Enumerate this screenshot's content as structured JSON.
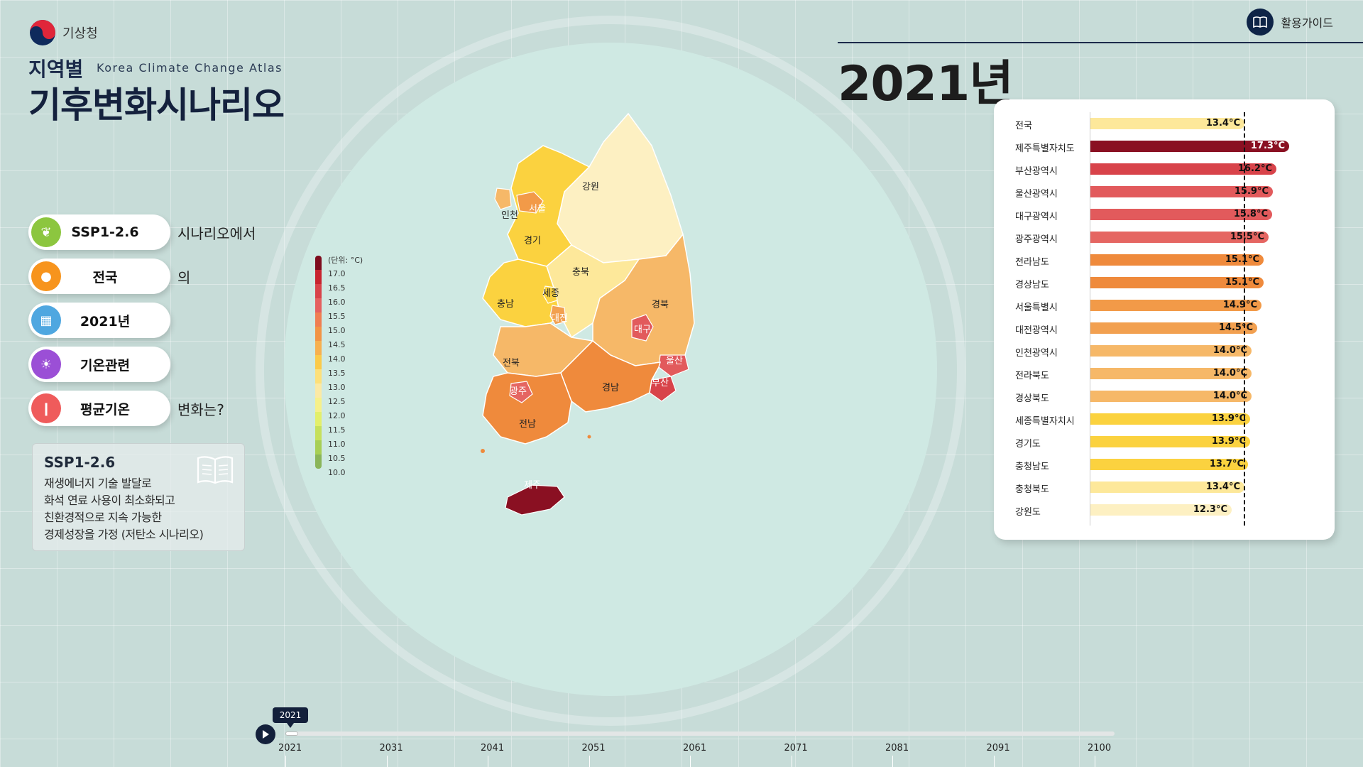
{
  "header": {
    "agency": "기상청",
    "title_sub": "지역별",
    "title_eng": "Korea Climate Change Atlas",
    "title_main": "기후변화시나리오",
    "guide_label": "활용가이드",
    "year_display": "2021년"
  },
  "selectors": [
    {
      "label": "SSP1-2.6",
      "suffix": "시나리오에서",
      "icon": "leaf-icon",
      "color": "#8cc63f"
    },
    {
      "label": "전국",
      "suffix": "의",
      "icon": "location-pin-icon",
      "color": "#f7941d"
    },
    {
      "label": "2021년",
      "suffix": "",
      "icon": "calendar-icon",
      "color": "#4fa7e0"
    },
    {
      "label": "기온관련",
      "suffix": "",
      "icon": "sun-icon",
      "color": "#9b4fd6"
    },
    {
      "label": "평균기온",
      "suffix": "변화는?",
      "icon": "thermometer-icon",
      "color": "#ef5b5b"
    }
  ],
  "description": {
    "title": "SSP1-2.6",
    "lines": [
      "재생에너지 기술 발달로",
      "화석 연료 사용이 최소화되고",
      "친환경적으로 지속 가능한",
      "경제성장을 가정 (저탄소 시나리오)"
    ]
  },
  "legend": {
    "unit": "(단위: °C)",
    "ticks": [
      "17.0",
      "16.5",
      "16.0",
      "15.5",
      "15.0",
      "14.5",
      "14.0",
      "13.5",
      "13.0",
      "12.5",
      "12.0",
      "11.5",
      "11.0",
      "10.5",
      "10.0"
    ],
    "colors": [
      "#7e0c1e",
      "#c8242f",
      "#d8434a",
      "#e5605f",
      "#ef7e52",
      "#f29445",
      "#f7b04f",
      "#fbca4a",
      "#fde07a",
      "#fbe9a5",
      "#f6f08a",
      "#e3ef6b",
      "#c6e05c",
      "#a7cf55",
      "#8ab55a"
    ]
  },
  "map": {
    "labels": [
      "강원",
      "인천",
      "서울",
      "경기",
      "충북",
      "경북",
      "세종",
      "충남",
      "대전",
      "대구",
      "전북",
      "울산",
      "경남",
      "부산",
      "광주",
      "전남",
      "제주"
    ]
  },
  "ranking": {
    "rows": [
      {
        "name": "전국",
        "value": 13.4,
        "label": "13.4°C",
        "color": "#fde89a"
      },
      {
        "name": "제주특별자치도",
        "value": 17.3,
        "label": "17.3°C",
        "color": "#8a1022"
      },
      {
        "name": "부산광역시",
        "value": 16.2,
        "label": "16.2°C",
        "color": "#d8434a"
      },
      {
        "name": "울산광역시",
        "value": 15.9,
        "label": "15.9°C",
        "color": "#e25a5c"
      },
      {
        "name": "대구광역시",
        "value": 15.8,
        "label": "15.8°C",
        "color": "#e25a5c"
      },
      {
        "name": "광주광역시",
        "value": 15.5,
        "label": "15.5°C",
        "color": "#e56662"
      },
      {
        "name": "전라남도",
        "value": 15.1,
        "label": "15.1°C",
        "color": "#ef8a3c"
      },
      {
        "name": "경상남도",
        "value": 15.1,
        "label": "15.1°C",
        "color": "#ef8a3c"
      },
      {
        "name": "서울특별시",
        "value": 14.9,
        "label": "14.9°C",
        "color": "#f29a48"
      },
      {
        "name": "대전광역시",
        "value": 14.5,
        "label": "14.5°C",
        "color": "#f2a050"
      },
      {
        "name": "인천광역시",
        "value": 14.0,
        "label": "14.0°C",
        "color": "#f6b868"
      },
      {
        "name": "전라북도",
        "value": 14.0,
        "label": "14.0°C",
        "color": "#f6b868"
      },
      {
        "name": "경상북도",
        "value": 14.0,
        "label": "14.0°C",
        "color": "#f6b868"
      },
      {
        "name": "세종특별자치시",
        "value": 13.9,
        "label": "13.9°C",
        "color": "#fbd23f"
      },
      {
        "name": "경기도",
        "value": 13.9,
        "label": "13.9°C",
        "color": "#fbd23f"
      },
      {
        "name": "충청남도",
        "value": 13.7,
        "label": "13.7°C",
        "color": "#fbd23f"
      },
      {
        "name": "충청북도",
        "value": 13.4,
        "label": "13.4°C",
        "color": "#fde89a"
      },
      {
        "name": "강원도",
        "value": 12.3,
        "label": "12.3°C",
        "color": "#fdf0c2"
      }
    ]
  },
  "timeline": {
    "current": "2021",
    "ticks": [
      "2021",
      "2031",
      "2041",
      "2051",
      "2061",
      "2071",
      "2081",
      "2091",
      "2100"
    ]
  }
}
